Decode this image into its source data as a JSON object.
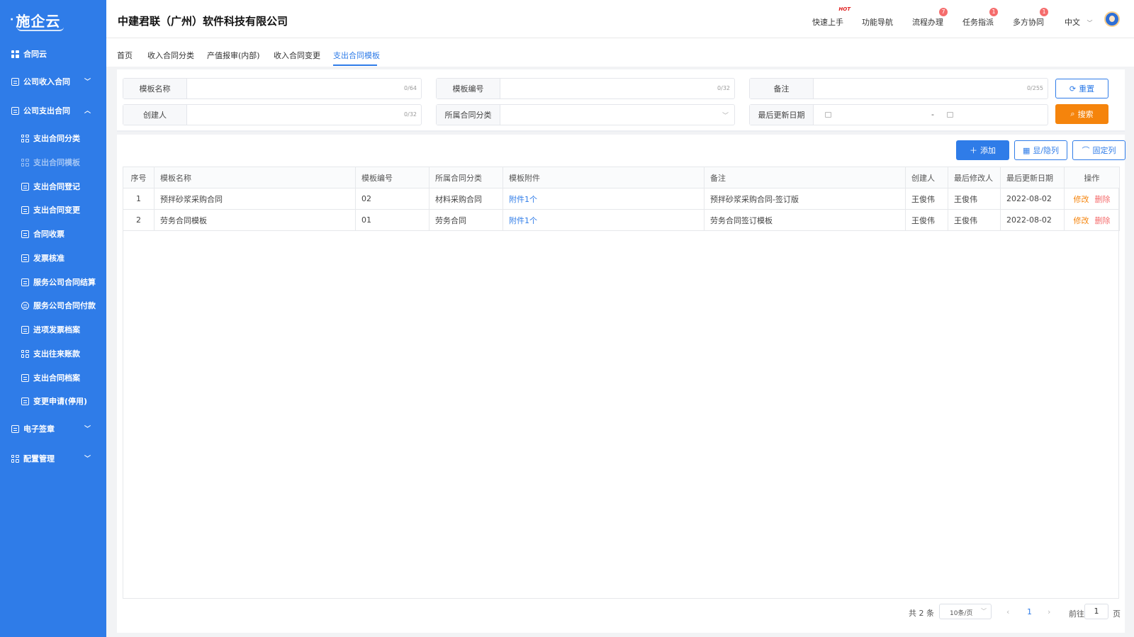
{
  "sidebar": {
    "logo": "施企云",
    "items": [
      {
        "label": "合同云",
        "icon": "grid-icon"
      },
      {
        "label": "公司收入合同",
        "icon": "document-icon"
      },
      {
        "label": "公司支出合同",
        "icon": "document-icon"
      },
      {
        "label": "支出合同分类",
        "icon": "grid-icon"
      },
      {
        "label": "支出合同模板",
        "icon": "template-icon"
      },
      {
        "label": "支出合同登记",
        "icon": "register-icon"
      },
      {
        "label": "支出合同变更",
        "icon": "change-icon"
      },
      {
        "label": "合同收票",
        "icon": "receipt-icon"
      },
      {
        "label": "发票核准",
        "icon": "invoice-icon"
      },
      {
        "label": "服务公司合同结算",
        "icon": "settlement-icon"
      },
      {
        "label": "服务公司合同付款",
        "icon": "payment-icon"
      },
      {
        "label": "进项发票档案",
        "icon": "archive-icon"
      },
      {
        "label": "支出往来账款",
        "icon": "calendar-icon"
      },
      {
        "label": "支出合同档案",
        "icon": "clipboard-icon"
      },
      {
        "label": "变更申请(停用)",
        "icon": "request-icon"
      },
      {
        "label": "电子签章",
        "icon": "document-icon"
      },
      {
        "label": "配置管理",
        "icon": "grid-icon"
      }
    ]
  },
  "header": {
    "company": "中建君联（广州）软件科技有限公司",
    "nav": [
      {
        "label": "快速上手",
        "badge": "HOT"
      },
      {
        "label": "功能导航",
        "badge": ""
      },
      {
        "label": "流程办理",
        "badge": "7"
      },
      {
        "label": "任务指派",
        "badge": "1"
      },
      {
        "label": "多方协同",
        "badge": "1"
      }
    ],
    "language": "中文"
  },
  "tabs": [
    "首页",
    "收入合同分类",
    "产值报审(内部)",
    "收入合同变更",
    "支出合同模板"
  ],
  "search": {
    "fields": [
      {
        "label": "模板名称",
        "counter": "0/64"
      },
      {
        "label": "模板编号",
        "counter": "0/32"
      },
      {
        "label": "备注",
        "counter": "0/255"
      },
      {
        "label": "创建人",
        "counter": "0/32"
      },
      {
        "label": "所属合同分类",
        "counter": ""
      },
      {
        "label": "最后更新日期",
        "counter": ""
      }
    ],
    "date_separator": "-",
    "reset_label": "重置",
    "search_label": "搜索"
  },
  "toolbar": {
    "add_label": "添加",
    "toggle_columns_label": "显/隐列",
    "fix_columns_label": "固定列"
  },
  "table": {
    "columns": [
      "序号",
      "模板名称",
      "模板编号",
      "所属合同分类",
      "模板附件",
      "备注",
      "创建人",
      "最后修改人",
      "最后更新日期",
      "操作"
    ],
    "rows": [
      {
        "no": "1",
        "name": "预拌砂浆采购合同",
        "code": "02",
        "category": "材料采购合同",
        "attachment": "附件1个",
        "remark": "预拌砂浆采购合同-签订版",
        "creator": "王俊伟",
        "modifier": "王俊伟",
        "date": "2022-08-02",
        "edit": "修改",
        "delete": "删除"
      },
      {
        "no": "2",
        "name": "劳务合同模板",
        "code": "01",
        "category": "劳务合同",
        "attachment": "附件1个",
        "remark": "劳务合同签订模板",
        "creator": "王俊伟",
        "modifier": "王俊伟",
        "date": "2022-08-02",
        "edit": "修改",
        "delete": "删除"
      }
    ]
  },
  "pagination": {
    "total": "共 2 条",
    "page_size": "10条/页",
    "current_page": "1",
    "goto_label": "前往",
    "goto_value": "1",
    "page_suffix": "页"
  },
  "colors": {
    "primary": "#2f7ce8",
    "orange": "#f5840c",
    "danger": "#f56c6c"
  }
}
